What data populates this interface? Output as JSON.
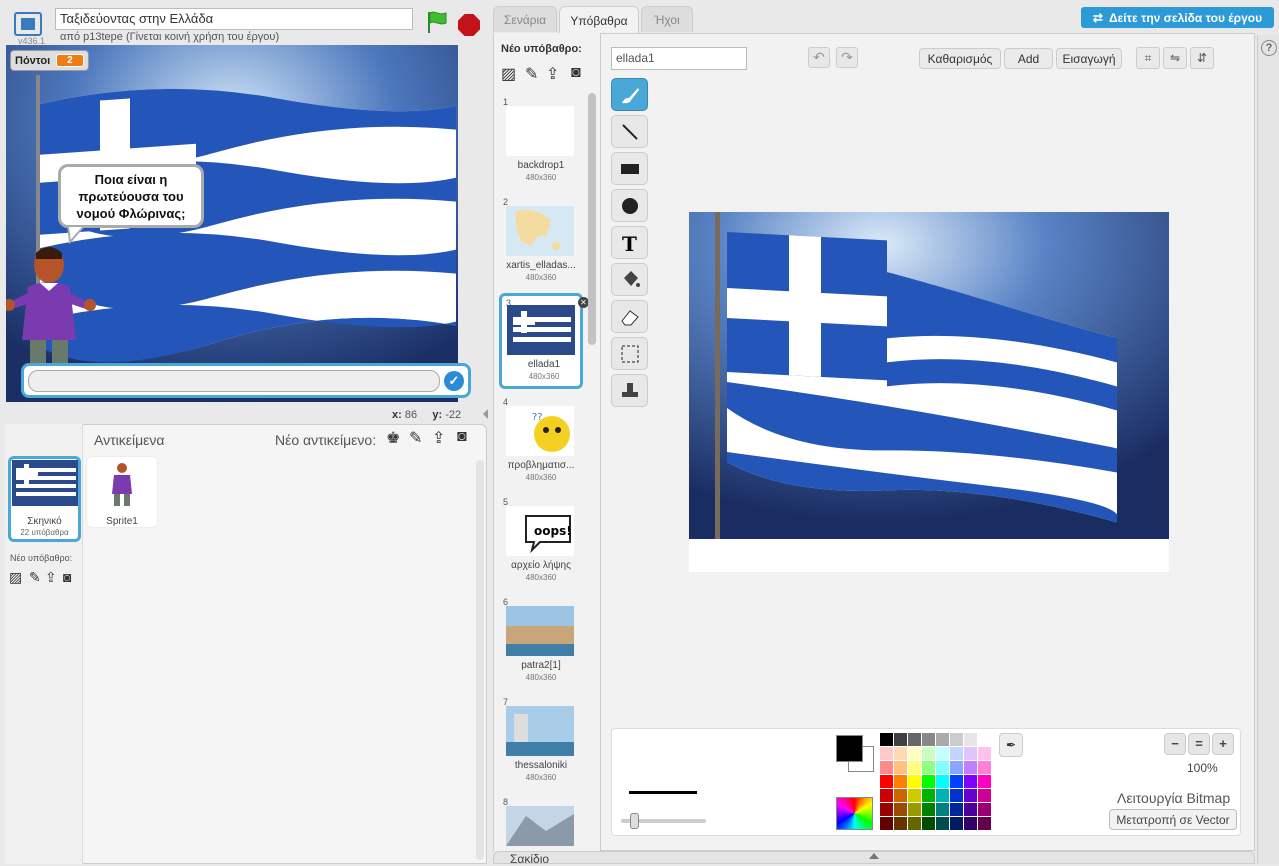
{
  "header": {
    "version": "v436.1",
    "project_title": "Ταξιδεύοντας στην Ελλάδα",
    "author_line": "από p13tepe (Γίνεται κοινή χρήση του έργου)"
  },
  "stage": {
    "variable_name": "Πόντοι",
    "variable_value": "2",
    "speech": "Ποια είναι η πρωτεύουσα του νομού Φλώρινας;",
    "coord_x_label": "x:",
    "coord_x": "86",
    "coord_y_label": "y:",
    "coord_y": "-22"
  },
  "sprite_pane": {
    "sprites_label": "Αντικείμενα",
    "new_sprite_label": "Νέο αντικείμενο:",
    "stage_name": "Σκηνικό",
    "stage_backdrops": "22 υπόβαθρα",
    "new_backdrop_label": "Νέο υπόβαθρο:",
    "sprite_name": "Sprite1"
  },
  "tabs": {
    "scripts": "Σενάρια",
    "backdrops": "Υπόβαθρα",
    "sounds": "Ήχοι"
  },
  "see_project_page": "Δείτε την σελίδα του έργου",
  "backdrop_list": {
    "new_backdrop_label": "Νέο υπόβαθρο:",
    "items": [
      {
        "num": "1",
        "name": "backdrop1",
        "size": "480x360"
      },
      {
        "num": "2",
        "name": "xartis_elladas...",
        "size": "480x360"
      },
      {
        "num": "3",
        "name": "ellada1",
        "size": "480x360"
      },
      {
        "num": "4",
        "name": "προβληματισ...",
        "size": "480x360"
      },
      {
        "num": "5",
        "name": "αρχείο λήψης",
        "size": "480x360"
      },
      {
        "num": "6",
        "name": "patra2[1]",
        "size": "480x360"
      },
      {
        "num": "7",
        "name": "thessaloniki",
        "size": "480x360"
      },
      {
        "num": "8",
        "name": "",
        "size": ""
      }
    ]
  },
  "editor": {
    "costume_name": "ellada1",
    "clear": "Καθαρισμός",
    "add": "Add",
    "import": "Εισαγωγή",
    "zoom_level": "100%",
    "mode": "Λειτουργία Bitmap",
    "convert": "Μετατροπή σε Vector",
    "backpack": "Σακίδιο"
  },
  "colors": {
    "accent": "#4aa8d8",
    "flag_blue": "#1f4fa8",
    "orange": "#ee7d16"
  },
  "palette": [
    "#000000",
    "#3f3f3f",
    "#666666",
    "#888888",
    "#aaaaaa",
    "#cccccc",
    "#e6e6e6",
    "#ffffff",
    "#ffc9c9",
    "#ffd9b3",
    "#ffffc2",
    "#caffc2",
    "#c2ffff",
    "#c2d4ff",
    "#e0c2ff",
    "#ffc2ec",
    "#ff8a8a",
    "#ffc080",
    "#ffff80",
    "#90ff80",
    "#80ffff",
    "#8aa6ff",
    "#c080ff",
    "#ff80d9",
    "#ff0000",
    "#ff8000",
    "#ffff00",
    "#00ff00",
    "#00ffff",
    "#0040ff",
    "#8000ff",
    "#ff00c0",
    "#cc0000",
    "#cc6600",
    "#cccc00",
    "#00b300",
    "#00b3b3",
    "#0033cc",
    "#6600cc",
    "#cc0099",
    "#990000",
    "#994c00",
    "#999900",
    "#008000",
    "#008080",
    "#002699",
    "#4c0099",
    "#990073",
    "#660000",
    "#663300",
    "#666600",
    "#004d00",
    "#004d4d",
    "#001a66",
    "#330066",
    "#66004d"
  ]
}
